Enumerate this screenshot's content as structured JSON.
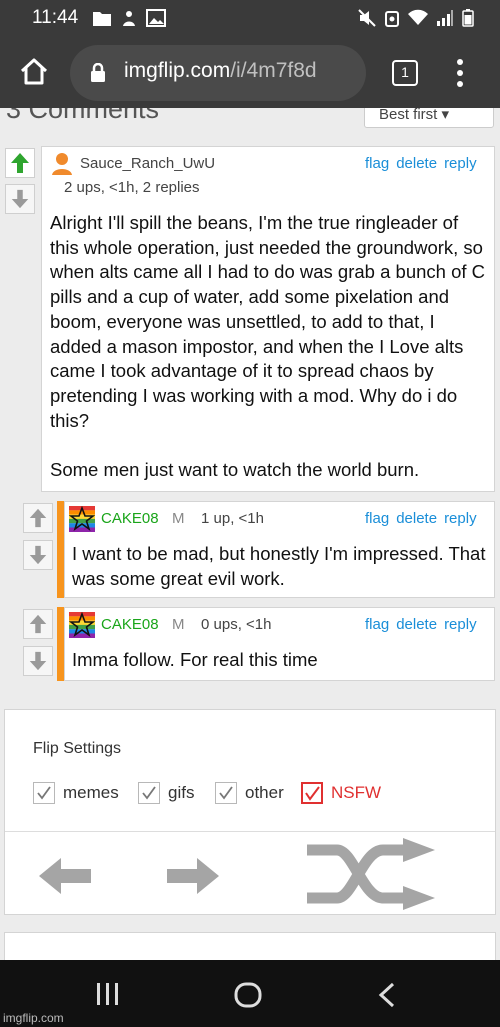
{
  "status_bar": {
    "time": "11:44"
  },
  "browser": {
    "domain": "imgflip.com",
    "path": "/i/4m7f8d",
    "tab_count": "1"
  },
  "comments_header": {
    "count_label": "3 Comments",
    "sort_label": "Best first"
  },
  "comments": [
    {
      "username": "Sauce_Ranch_UwU",
      "meta": "2 ups, <1h, 2 replies",
      "actions": [
        "flag",
        "delete",
        "reply"
      ],
      "body": "Alright I'll spill the beans, I'm the true ringleader of this whole operation, just needed the groundwork, so when alts came all I had to do was grab a bunch of C pills and a cup of water, add some pixelation and boom, everyone was unsettled, to add to that, I added a mason impostor, and when the I Love alts came I took advantage of it to spread chaos by pretending I was working with a mod. Why do i do this?\n\nSome men just want to watch the world burn."
    },
    {
      "username": "CAKE08",
      "mod_badge": "M",
      "meta": "1 up, <1h",
      "actions": [
        "flag",
        "delete",
        "reply"
      ],
      "body": "I want to be mad, but honestly I'm impressed. That was some great evil work."
    },
    {
      "username": "CAKE08",
      "mod_badge": "M",
      "meta": "0 ups, <1h",
      "actions": [
        "flag",
        "delete",
        "reply"
      ],
      "body": "Imma follow. For real this time"
    }
  ],
  "flip_settings": {
    "title": "Flip Settings",
    "options": [
      {
        "label": "memes",
        "checked": true
      },
      {
        "label": "gifs",
        "checked": true
      },
      {
        "label": "other",
        "checked": true
      },
      {
        "label": "NSFW",
        "checked": true
      }
    ]
  },
  "watermark": "imgflip.com",
  "colors": {
    "upvote_active": "#2fa52f",
    "reply_bar": "#f7941d",
    "link": "#1a8ed8",
    "mod_name": "#1aa51a",
    "nsfw": "#e03030"
  }
}
